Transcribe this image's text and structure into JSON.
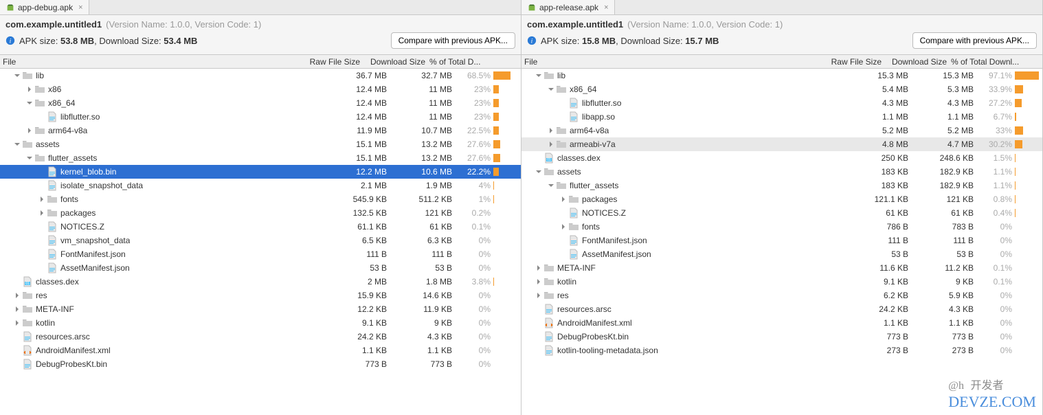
{
  "left": {
    "tab": "app-debug.apk",
    "package": "com.example.untitled1",
    "version_label": "(Version Name: 1.0.0, Version Code: 1)",
    "size_prefix": "APK size: ",
    "apk_size": "53.8 MB",
    "dl_prefix": ", Download Size: ",
    "dl_size": "53.4 MB",
    "compare_label": "Compare with previous APK...",
    "headers": {
      "file": "File",
      "raw": "Raw File Size",
      "dl": "Download Size",
      "pct": "% of Total D..."
    },
    "rows": [
      {
        "indent": 0,
        "caret": "down",
        "icon": "folder",
        "name": "lib",
        "raw": "36.7 MB",
        "dl": "32.7 MB",
        "pct": "68.5%",
        "bar": 68.5
      },
      {
        "indent": 1,
        "caret": "right",
        "icon": "folder",
        "name": "x86",
        "raw": "12.4 MB",
        "dl": "11 MB",
        "pct": "23%",
        "bar": 23
      },
      {
        "indent": 1,
        "caret": "down",
        "icon": "folder",
        "name": "x86_64",
        "raw": "12.4 MB",
        "dl": "11 MB",
        "pct": "23%",
        "bar": 23
      },
      {
        "indent": 2,
        "caret": "none",
        "icon": "file",
        "name": "libflutter.so",
        "raw": "12.4 MB",
        "dl": "11 MB",
        "pct": "23%",
        "bar": 23
      },
      {
        "indent": 1,
        "caret": "right",
        "icon": "folder",
        "name": "arm64-v8a",
        "raw": "11.9 MB",
        "dl": "10.7 MB",
        "pct": "22.5%",
        "bar": 22.5
      },
      {
        "indent": 0,
        "caret": "down",
        "icon": "folder",
        "name": "assets",
        "raw": "15.1 MB",
        "dl": "13.2 MB",
        "pct": "27.6%",
        "bar": 27.6
      },
      {
        "indent": 1,
        "caret": "down",
        "icon": "folder",
        "name": "flutter_assets",
        "raw": "15.1 MB",
        "dl": "13.2 MB",
        "pct": "27.6%",
        "bar": 27.6
      },
      {
        "indent": 2,
        "caret": "none",
        "icon": "file",
        "name": "kernel_blob.bin",
        "raw": "12.2 MB",
        "dl": "10.6 MB",
        "pct": "22.2%",
        "bar": 22.2,
        "selected": true
      },
      {
        "indent": 2,
        "caret": "none",
        "icon": "file",
        "name": "isolate_snapshot_data",
        "raw": "2.1 MB",
        "dl": "1.9 MB",
        "pct": "4%",
        "bar": 4
      },
      {
        "indent": 2,
        "caret": "right",
        "icon": "folder",
        "name": "fonts",
        "raw": "545.9 KB",
        "dl": "511.2 KB",
        "pct": "1%",
        "bar": 1
      },
      {
        "indent": 2,
        "caret": "right",
        "icon": "folder",
        "name": "packages",
        "raw": "132.5 KB",
        "dl": "121 KB",
        "pct": "0.2%",
        "bar": 0.2
      },
      {
        "indent": 2,
        "caret": "none",
        "icon": "file",
        "name": "NOTICES.Z",
        "raw": "61.1 KB",
        "dl": "61 KB",
        "pct": "0.1%",
        "bar": 0.1
      },
      {
        "indent": 2,
        "caret": "none",
        "icon": "file",
        "name": "vm_snapshot_data",
        "raw": "6.5 KB",
        "dl": "6.3 KB",
        "pct": "0%",
        "bar": 0
      },
      {
        "indent": 2,
        "caret": "none",
        "icon": "file",
        "name": "FontManifest.json",
        "raw": "111 B",
        "dl": "111 B",
        "pct": "0%",
        "bar": 0
      },
      {
        "indent": 2,
        "caret": "none",
        "icon": "file",
        "name": "AssetManifest.json",
        "raw": "53 B",
        "dl": "53 B",
        "pct": "0%",
        "bar": 0
      },
      {
        "indent": 0,
        "caret": "none",
        "icon": "dex",
        "name": "classes.dex",
        "raw": "2 MB",
        "dl": "1.8 MB",
        "pct": "3.8%",
        "bar": 3.8
      },
      {
        "indent": 0,
        "caret": "right",
        "icon": "folder",
        "name": "res",
        "raw": "15.9 KB",
        "dl": "14.6 KB",
        "pct": "0%",
        "bar": 0
      },
      {
        "indent": 0,
        "caret": "right",
        "icon": "folder",
        "name": "META-INF",
        "raw": "12.2 KB",
        "dl": "11.9 KB",
        "pct": "0%",
        "bar": 0
      },
      {
        "indent": 0,
        "caret": "right",
        "icon": "folder",
        "name": "kotlin",
        "raw": "9.1 KB",
        "dl": "9 KB",
        "pct": "0%",
        "bar": 0
      },
      {
        "indent": 0,
        "caret": "none",
        "icon": "file",
        "name": "resources.arsc",
        "raw": "24.2 KB",
        "dl": "4.3 KB",
        "pct": "0%",
        "bar": 0
      },
      {
        "indent": 0,
        "caret": "none",
        "icon": "xml",
        "name": "AndroidManifest.xml",
        "raw": "1.1 KB",
        "dl": "1.1 KB",
        "pct": "0%",
        "bar": 0
      },
      {
        "indent": 0,
        "caret": "none",
        "icon": "file",
        "name": "DebugProbesKt.bin",
        "raw": "773 B",
        "dl": "773 B",
        "pct": "0%",
        "bar": 0
      }
    ]
  },
  "right": {
    "tab": "app-release.apk",
    "package": "com.example.untitled1",
    "version_label": "(Version Name: 1.0.0, Version Code: 1)",
    "size_prefix": "APK size: ",
    "apk_size": "15.8 MB",
    "dl_prefix": ", Download Size: ",
    "dl_size": "15.7 MB",
    "compare_label": "Compare with previous APK...",
    "headers": {
      "file": "File",
      "raw": "Raw File Size",
      "dl": "Download Size",
      "pct": "% of Total Downl..."
    },
    "rows": [
      {
        "indent": 0,
        "caret": "down",
        "icon": "folder",
        "name": "lib",
        "raw": "15.3 MB",
        "dl": "15.3 MB",
        "pct": "97.1%",
        "bar": 97.1
      },
      {
        "indent": 1,
        "caret": "down",
        "icon": "folder",
        "name": "x86_64",
        "raw": "5.4 MB",
        "dl": "5.3 MB",
        "pct": "33.9%",
        "bar": 33.9
      },
      {
        "indent": 2,
        "caret": "none",
        "icon": "file",
        "name": "libflutter.so",
        "raw": "4.3 MB",
        "dl": "4.3 MB",
        "pct": "27.2%",
        "bar": 27.2
      },
      {
        "indent": 2,
        "caret": "none",
        "icon": "file",
        "name": "libapp.so",
        "raw": "1.1 MB",
        "dl": "1.1 MB",
        "pct": "6.7%",
        "bar": 6.7
      },
      {
        "indent": 1,
        "caret": "right",
        "icon": "folder",
        "name": "arm64-v8a",
        "raw": "5.2 MB",
        "dl": "5.2 MB",
        "pct": "33%",
        "bar": 33
      },
      {
        "indent": 1,
        "caret": "right",
        "icon": "folder",
        "name": "armeabi-v7a",
        "raw": "4.8 MB",
        "dl": "4.7 MB",
        "pct": "30.2%",
        "bar": 30.2,
        "highlight": true
      },
      {
        "indent": 0,
        "caret": "none",
        "icon": "dex",
        "name": "classes.dex",
        "raw": "250 KB",
        "dl": "248.6 KB",
        "pct": "1.5%",
        "bar": 1.5
      },
      {
        "indent": 0,
        "caret": "down",
        "icon": "folder",
        "name": "assets",
        "raw": "183 KB",
        "dl": "182.9 KB",
        "pct": "1.1%",
        "bar": 1.1
      },
      {
        "indent": 1,
        "caret": "down",
        "icon": "folder",
        "name": "flutter_assets",
        "raw": "183 KB",
        "dl": "182.9 KB",
        "pct": "1.1%",
        "bar": 1.1
      },
      {
        "indent": 2,
        "caret": "right",
        "icon": "folder",
        "name": "packages",
        "raw": "121.1 KB",
        "dl": "121 KB",
        "pct": "0.8%",
        "bar": 0.8
      },
      {
        "indent": 2,
        "caret": "none",
        "icon": "file",
        "name": "NOTICES.Z",
        "raw": "61 KB",
        "dl": "61 KB",
        "pct": "0.4%",
        "bar": 0.4
      },
      {
        "indent": 2,
        "caret": "right",
        "icon": "folder",
        "name": "fonts",
        "raw": "786 B",
        "dl": "783 B",
        "pct": "0%",
        "bar": 0
      },
      {
        "indent": 2,
        "caret": "none",
        "icon": "file",
        "name": "FontManifest.json",
        "raw": "111 B",
        "dl": "111 B",
        "pct": "0%",
        "bar": 0
      },
      {
        "indent": 2,
        "caret": "none",
        "icon": "file",
        "name": "AssetManifest.json",
        "raw": "53 B",
        "dl": "53 B",
        "pct": "0%",
        "bar": 0
      },
      {
        "indent": 0,
        "caret": "right",
        "icon": "folder",
        "name": "META-INF",
        "raw": "11.6 KB",
        "dl": "11.2 KB",
        "pct": "0.1%",
        "bar": 0.1
      },
      {
        "indent": 0,
        "caret": "right",
        "icon": "folder",
        "name": "kotlin",
        "raw": "9.1 KB",
        "dl": "9 KB",
        "pct": "0.1%",
        "bar": 0.1
      },
      {
        "indent": 0,
        "caret": "right",
        "icon": "folder",
        "name": "res",
        "raw": "6.2 KB",
        "dl": "5.9 KB",
        "pct": "0%",
        "bar": 0
      },
      {
        "indent": 0,
        "caret": "none",
        "icon": "file",
        "name": "resources.arsc",
        "raw": "24.2 KB",
        "dl": "4.3 KB",
        "pct": "0%",
        "bar": 0
      },
      {
        "indent": 0,
        "caret": "none",
        "icon": "xml",
        "name": "AndroidManifest.xml",
        "raw": "1.1 KB",
        "dl": "1.1 KB",
        "pct": "0%",
        "bar": 0
      },
      {
        "indent": 0,
        "caret": "none",
        "icon": "file",
        "name": "DebugProbesKt.bin",
        "raw": "773 B",
        "dl": "773 B",
        "pct": "0%",
        "bar": 0
      },
      {
        "indent": 0,
        "caret": "none",
        "icon": "file",
        "name": "kotlin-tooling-metadata.json",
        "raw": "273 B",
        "dl": "273 B",
        "pct": "0%",
        "bar": 0
      }
    ]
  },
  "watermark": {
    "cn": "开发者",
    "en": "DEVZE.COM",
    "at": "@h"
  }
}
